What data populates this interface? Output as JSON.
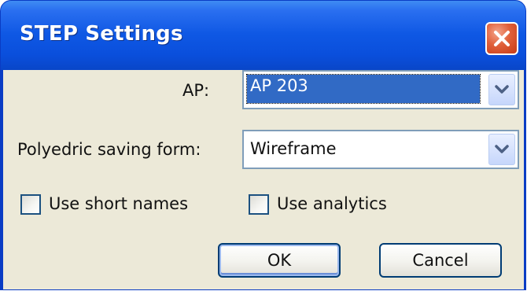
{
  "window": {
    "title": "STEP Settings",
    "close_icon": "close-icon"
  },
  "form": {
    "ap_label": "AP:",
    "ap_value": "AP 203",
    "polyedric_label": "Polyedric saving form:",
    "polyedric_value": "Wireframe",
    "short_names_label": "Use short names",
    "short_names_checked": false,
    "analytics_label": "Use analytics",
    "analytics_checked": false
  },
  "buttons": {
    "ok_label": "OK",
    "cancel_label": "Cancel"
  },
  "colors": {
    "titlebar": "#0a4fdc",
    "dialog_face": "#ece9d8",
    "selection": "#316ac5",
    "close_button": "#e0603a"
  }
}
